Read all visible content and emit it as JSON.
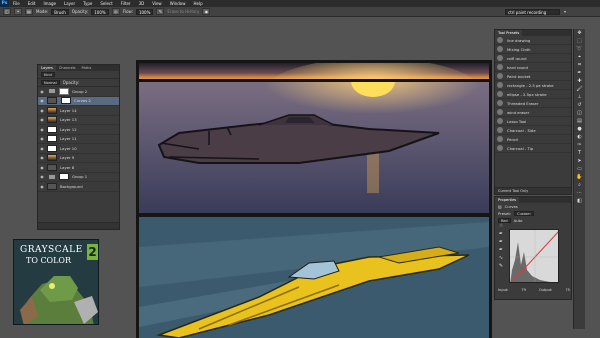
{
  "menubar": {
    "logo": "Ps",
    "items": [
      "File",
      "Edit",
      "Image",
      "Layer",
      "Type",
      "Select",
      "Filter",
      "3D",
      "View",
      "Window",
      "Help"
    ]
  },
  "options": {
    "mode_label": "Mode:",
    "mode_value": "Brush",
    "opacity_label": "Opacity:",
    "opacity_value": "100%",
    "flow_label": "Flow:",
    "flow_value": "100%",
    "erase_history": "Erase to History",
    "workspace": "ctrl paint recording"
  },
  "layers_panel": {
    "tabs": [
      "Layers",
      "Channels",
      "Paths"
    ],
    "kind_label": "Kind",
    "blend_mode": "Normal",
    "opacity_label": "Opacity:",
    "rows": [
      {
        "name": "Group 2",
        "type": "group"
      },
      {
        "name": "Curves 2",
        "type": "adjust",
        "selected": true
      },
      {
        "name": "Layer 14",
        "type": "layer"
      },
      {
        "name": "Layer 13",
        "type": "layer"
      },
      {
        "name": "Layer 12",
        "type": "layer"
      },
      {
        "name": "Layer 11",
        "type": "layer"
      },
      {
        "name": "Layer 10",
        "type": "layer"
      },
      {
        "name": "Layer 9",
        "type": "layer"
      },
      {
        "name": "Layer 8",
        "type": "layer"
      },
      {
        "name": "Group 1",
        "type": "group"
      },
      {
        "name": "Background",
        "type": "bg"
      }
    ]
  },
  "tool_presets": {
    "title": "Tool Presets",
    "items": [
      "line drawing",
      "Mixing Cloth",
      "rolfl round",
      "hard round",
      "Paint bucket",
      "rectangle - 2.5 pe stroke",
      "ellipse - 2.5px stroke",
      "Threaded Eraser",
      "wind eraser",
      "Lasso Tool",
      "Charcoal - Side",
      "Pencil",
      "Charcoal - Tip"
    ],
    "footer": "Current Tool Only"
  },
  "properties": {
    "title": "Properties",
    "adjustment": "Curves",
    "preset_label": "Preset:",
    "preset_value": "Custom",
    "channel": "Red",
    "auto": "Auto",
    "input_label": "Input:",
    "input_value": "79",
    "output_label": "Output:",
    "output_value": "75"
  },
  "book": {
    "title": "GRAYSCALE",
    "subtitle": "TO COLOR",
    "number": "2"
  },
  "colors": {
    "menubar": "#2c2c2c",
    "workspace": "#535353",
    "panel": "#3b3b3b",
    "selection": "#5a6a80",
    "sun": "#ffd24a",
    "boat_yellow": "#e9c21e"
  }
}
